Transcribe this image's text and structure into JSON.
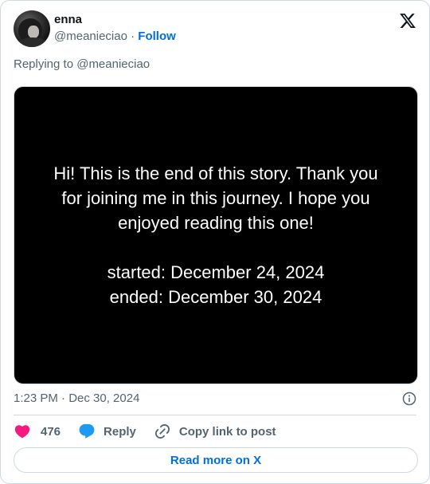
{
  "author": {
    "name": "enna",
    "handle": "@meanieciao",
    "separator": "·",
    "follow_label": "Follow"
  },
  "replying_to": "Replying to @meanieciao",
  "media": {
    "lines": [
      "Hi! This is the end of this story. Thank you",
      "for joining me in this journey. I hope you",
      "enjoyed reading this one!",
      "started: December 24, 2024",
      "ended: December 30, 2024"
    ]
  },
  "timestamp": "1:23 PM · Dec 30, 2024",
  "actions": {
    "like_count": "476",
    "reply_label": "Reply",
    "copy_label": "Copy link to post"
  },
  "read_more_label": "Read more on X",
  "colors": {
    "link": "#006fd6",
    "heart": "#f91880",
    "reply_bubble": "#1d9bf0",
    "secondary_text": "#536471",
    "border": "#cfd9de"
  },
  "icons": [
    "x-logo-icon",
    "info-icon",
    "heart-icon",
    "reply-bubble-icon",
    "link-icon"
  ]
}
